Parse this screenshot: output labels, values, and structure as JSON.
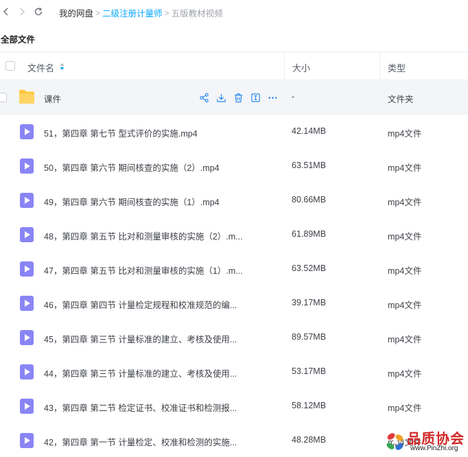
{
  "breadcrumb": {
    "root": "我的网盘",
    "separator": ">",
    "folder": "二级注册计量师",
    "current": "五版教材视频"
  },
  "section_title": "全部文件",
  "table": {
    "col_name": "文件名",
    "col_size": "大小",
    "col_type": "类型"
  },
  "folder_row": {
    "name": "课件",
    "size": "-",
    "type": "文件夹",
    "actions": [
      "share-icon",
      "download-icon",
      "delete-icon",
      "rename-icon",
      "more-icon"
    ]
  },
  "files": [
    {
      "name": "51，第四章 第七节 型式评价的实施.mp4",
      "size": "42.14MB",
      "type": "mp4文件"
    },
    {
      "name": "50，第四章 第六节 期间核查的实施（2）.mp4",
      "size": "63.51MB",
      "type": "mp4文件"
    },
    {
      "name": "49，第四章 第六节 期间核查的实施（1）.mp4",
      "size": "80.66MB",
      "type": "mp4文件"
    },
    {
      "name": "48，第四章 第五节 比对和测量审核的实施（2）.m...",
      "size": "61.89MB",
      "type": "mp4文件"
    },
    {
      "name": "47，第四章 第五节 比对和测量审核的实施（1）.m...",
      "size": "63.52MB",
      "type": "mp4文件"
    },
    {
      "name": "46，第四章 第四节 计量检定规程和校准规范的编...",
      "size": "39.17MB",
      "type": "mp4文件"
    },
    {
      "name": "45，第四章 第三节 计量标准的建立、考核及使用...",
      "size": "89.57MB",
      "type": "mp4文件"
    },
    {
      "name": "44，第四章 第三节 计量标准的建立、考核及使用...",
      "size": "53.17MB",
      "type": "mp4文件"
    },
    {
      "name": "43，第四章 第二节 检定证书、校准证书和检测报...",
      "size": "58.12MB",
      "type": "mp4文件"
    },
    {
      "name": "42，第四章 第一节 计量检定、校准和检测的实施...",
      "size": "48.28MB",
      "type": "mp4文件"
    }
  ],
  "watermark": {
    "text": "品质协会",
    "url": "www.PinZhi.org"
  },
  "colors": {
    "accent": "#06a7ff",
    "folder": "#ffc63d",
    "video": "#8a85f5",
    "action_icons": "#2d8cf0",
    "watermark_red": "#d02626"
  }
}
